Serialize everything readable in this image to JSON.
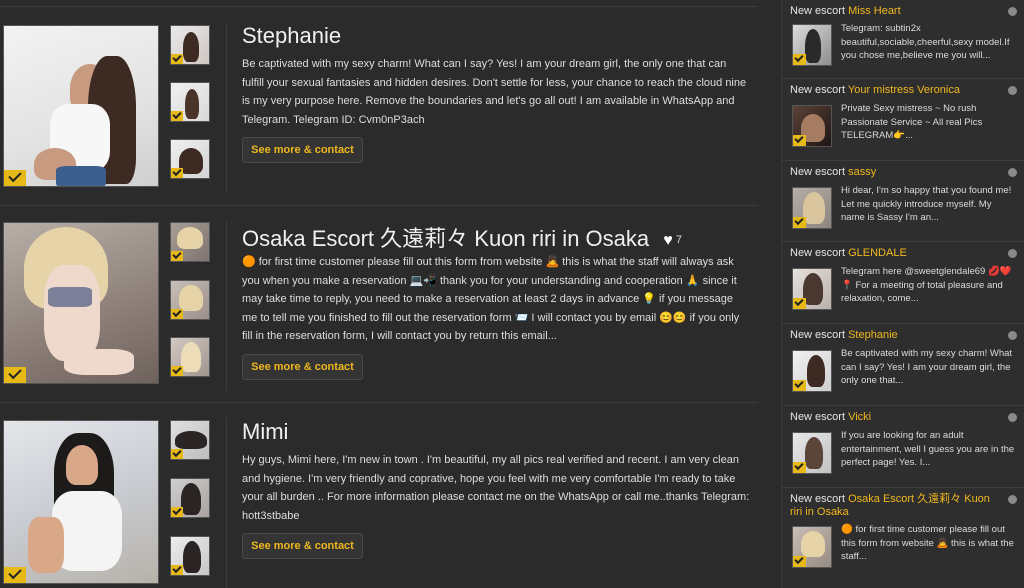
{
  "listings": [
    {
      "name": "Stephanie",
      "likes": "",
      "description": "Be captivated with my sexy charm! What can I say? Yes! I am your dream girl, the only one that can fulfill your sexual fantasies and hidden desires. Don't settle for less, your chance to reach the cloud nine is my very purpose here. Remove the boundaries and let's go all out! I am available in WhatsApp and Telegram. Telegram ID: Cvm0nP3ach",
      "button": "See more & contact"
    },
    {
      "name": "Osaka Escort 久遠莉々 Kuon riri in Osaka",
      "likes": "7",
      "description": "🟠 for first time customer please fill out this form from website 🙇 this is what the staff will always ask you when you make a reservation 💻📲 thank you for your understanding and cooperation 🙏 since it may take time to reply, you need to make a reservation at least 2 days in advance 💡 if you message me to tell me you finished to fill out the reservation form 📨 I will contact you by email 😊😊 if you only fill in the reservation form, I will contact you by return this email...",
      "button": "See more & contact"
    },
    {
      "name": "Mimi",
      "likes": "",
      "description": "Hy guys, Mimi here, I'm new in town . I'm beautiful, my all pics real verified and recent. I am very clean and hygiene. I'm very friendly and coprative, hope you feel with me very comfortable I'm ready to take your all burden .. For more information please contact me on the WhatsApp or call me..thanks Telegram: hott3stbabe",
      "button": "See more & contact"
    }
  ],
  "sidebar": [
    {
      "prefix": "New escort",
      "name": "Miss Heart",
      "text": "Telegram: subtin2x beautiful,sociable,cheerful,sexy model.If you chose me,believe me you will..."
    },
    {
      "prefix": "New escort",
      "name": "Your mistress Veronica",
      "text": "Private Sexy mistress ~ No rush Passionate Service ~ All real Pics TELEGRAM👉..."
    },
    {
      "prefix": "New escort",
      "name": "sassy",
      "text": "Hi dear, I'm so happy that you found me! Let me quickly introduce myself. My name is Sassy I'm an..."
    },
    {
      "prefix": "New escort",
      "name": "GLENDALE",
      "text": "Telegram here @sweetglendale69 💋❤️ 📍 For a meeting of total pleasure and relaxation, come..."
    },
    {
      "prefix": "New escort",
      "name": "Stephanie",
      "text": "Be captivated with my sexy charm! What can I say? Yes! I am your dream girl, the only one that..."
    },
    {
      "prefix": "New escort",
      "name": "Vicki",
      "text": "If you are looking for an adult entertainment, well I guess you are in the perfect page! Yes. I..."
    },
    {
      "prefix": "New escort",
      "name": "Osaka Escort 久遠莉々 Kuon riri in Osaka",
      "text": "🟠 for first time customer please fill out this form from website 🙇 this is what the staff..."
    }
  ],
  "colors": {
    "accent": "#f0b81e",
    "background": "#2b2b2b",
    "sidebar": "#2e2e2e",
    "badge": "#e6b917"
  },
  "icons": {
    "verified": "checkmark-icon",
    "likes": "heart-icon",
    "status": "dot-icon"
  }
}
